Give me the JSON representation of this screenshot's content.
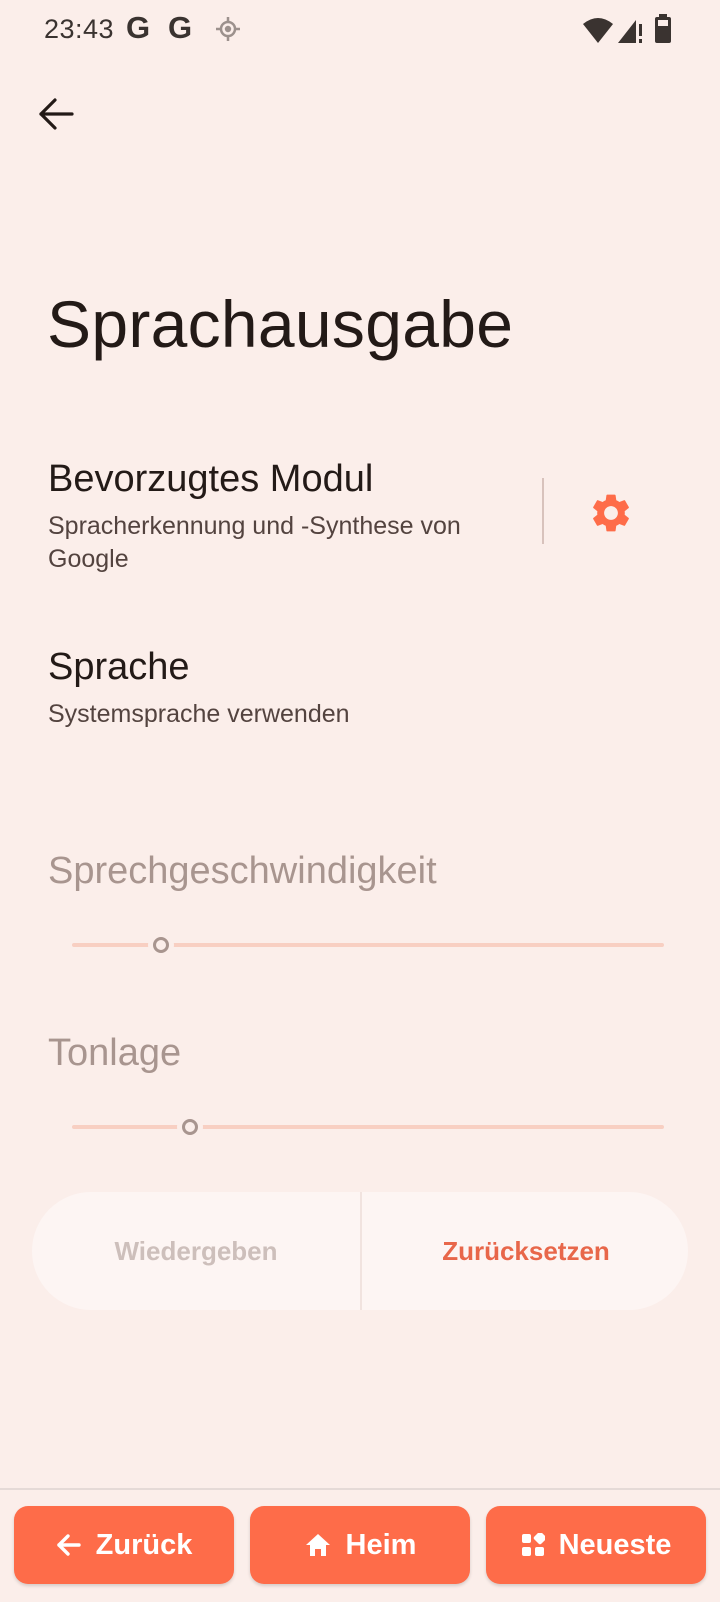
{
  "status_bar": {
    "time": "23:43",
    "g_letter_1": "G",
    "g_letter_2": "G"
  },
  "header": {
    "title": "Sprachausgabe"
  },
  "preferences": {
    "engine": {
      "title": "Bevorzugtes Modul",
      "summary": "Spracherkennung und -Synthese von Google"
    },
    "language": {
      "title": "Sprache",
      "summary": "Systemsprache verwenden"
    }
  },
  "sliders": {
    "rate": {
      "label": "Sprechgeschwindigkeit",
      "value_fraction": 0.15
    },
    "pitch": {
      "label": "Tonlage",
      "value_fraction": 0.2
    }
  },
  "actions": {
    "play_label": "Wiedergeben",
    "reset_label": "Zurücksetzen"
  },
  "bottom_nav": {
    "back_label": "Zurück",
    "home_label": "Heim",
    "recents_label": "Neueste"
  },
  "colors": {
    "background": "#FBEEEA",
    "accent": "#FE6C49",
    "accent_text": "#E8674A",
    "disabled_text": "#A8958F",
    "slider_track": "#F8CFC2"
  },
  "icons": {
    "back": "arrow-left-icon",
    "settings": "gear-icon",
    "location": "location-icon",
    "wifi": "wifi-icon",
    "signal": "signal-icon",
    "battery": "battery-icon",
    "home": "home-icon",
    "recents": "apps-grid-icon"
  }
}
